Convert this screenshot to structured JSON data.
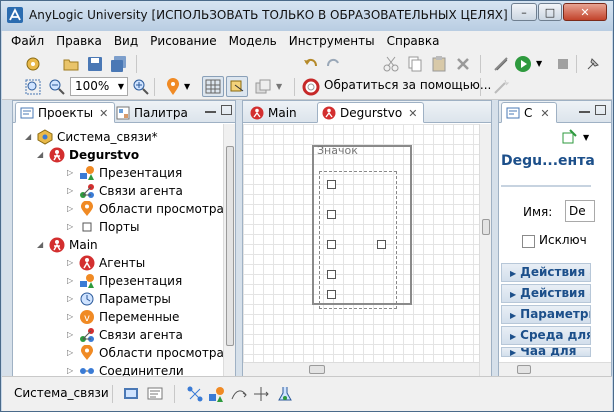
{
  "window": {
    "title": "AnyLogic University [ИСПОЛЬЗОВАТЬ ТОЛЬКО В ОБРАЗОВАТЕЛЬНЫХ ЦЕЛЯХ]",
    "minimize": "–",
    "maximize": "□",
    "close": "✕"
  },
  "menu": [
    "Файл",
    "Правка",
    "Вид",
    "Рисование",
    "Модель",
    "Инструменты",
    "Справка"
  ],
  "toolbar": {
    "zoom_value": "100%",
    "help_label": "Обратиться за помощью..."
  },
  "projects_panel": {
    "tabs": [
      {
        "label": "Проекты",
        "close": "✕"
      },
      {
        "label": "Палитра"
      }
    ],
    "tree": [
      {
        "label": "Система_связи*",
        "icon": "model-icon",
        "bold": false,
        "level": 0
      },
      {
        "label": "Degurstvo",
        "icon": "agent-type-icon",
        "bold": true,
        "level": 1
      },
      {
        "label": "Презентация",
        "icon": "presentation-icon",
        "bold": false,
        "level": 2
      },
      {
        "label": "Связи агента",
        "icon": "agent-links-icon",
        "bold": false,
        "level": 2
      },
      {
        "label": "Области просмотра",
        "icon": "viewarea-icon",
        "bold": false,
        "level": 2
      },
      {
        "label": "Порты",
        "icon": "ports-icon",
        "bold": false,
        "level": 2
      },
      {
        "label": "Main",
        "icon": "agent-type-icon",
        "bold": false,
        "level": 1
      },
      {
        "label": "Агенты",
        "icon": "agents-icon",
        "bold": false,
        "level": 2
      },
      {
        "label": "Презентация",
        "icon": "presentation-icon",
        "bold": false,
        "level": 2
      },
      {
        "label": "Параметры",
        "icon": "parameters-icon",
        "bold": false,
        "level": 2
      },
      {
        "label": "Переменные",
        "icon": "variables-icon",
        "bold": false,
        "level": 2
      },
      {
        "label": "Связи агента",
        "icon": "agent-links-icon",
        "bold": false,
        "level": 2
      },
      {
        "label": "Области просмотра",
        "icon": "viewarea-icon",
        "bold": false,
        "level": 2
      },
      {
        "label": "Соединители",
        "icon": "connectors-icon",
        "bold": false,
        "level": 2
      }
    ]
  },
  "editor": {
    "tabs": [
      {
        "label": "Main"
      },
      {
        "label": "Degurstvo",
        "close": "✕"
      }
    ],
    "icon_label": "Значок"
  },
  "properties": {
    "tab_label": "С",
    "tab_close": "✕",
    "title": "Degu...ента",
    "name_label": "Имя:",
    "name_value": "De",
    "checkbox_label": "Исключ",
    "sections": [
      "Действия а",
      "Действия а",
      "Параметры",
      "Среда для",
      "Чаа для"
    ]
  },
  "status": {
    "text": "Система_связи"
  }
}
